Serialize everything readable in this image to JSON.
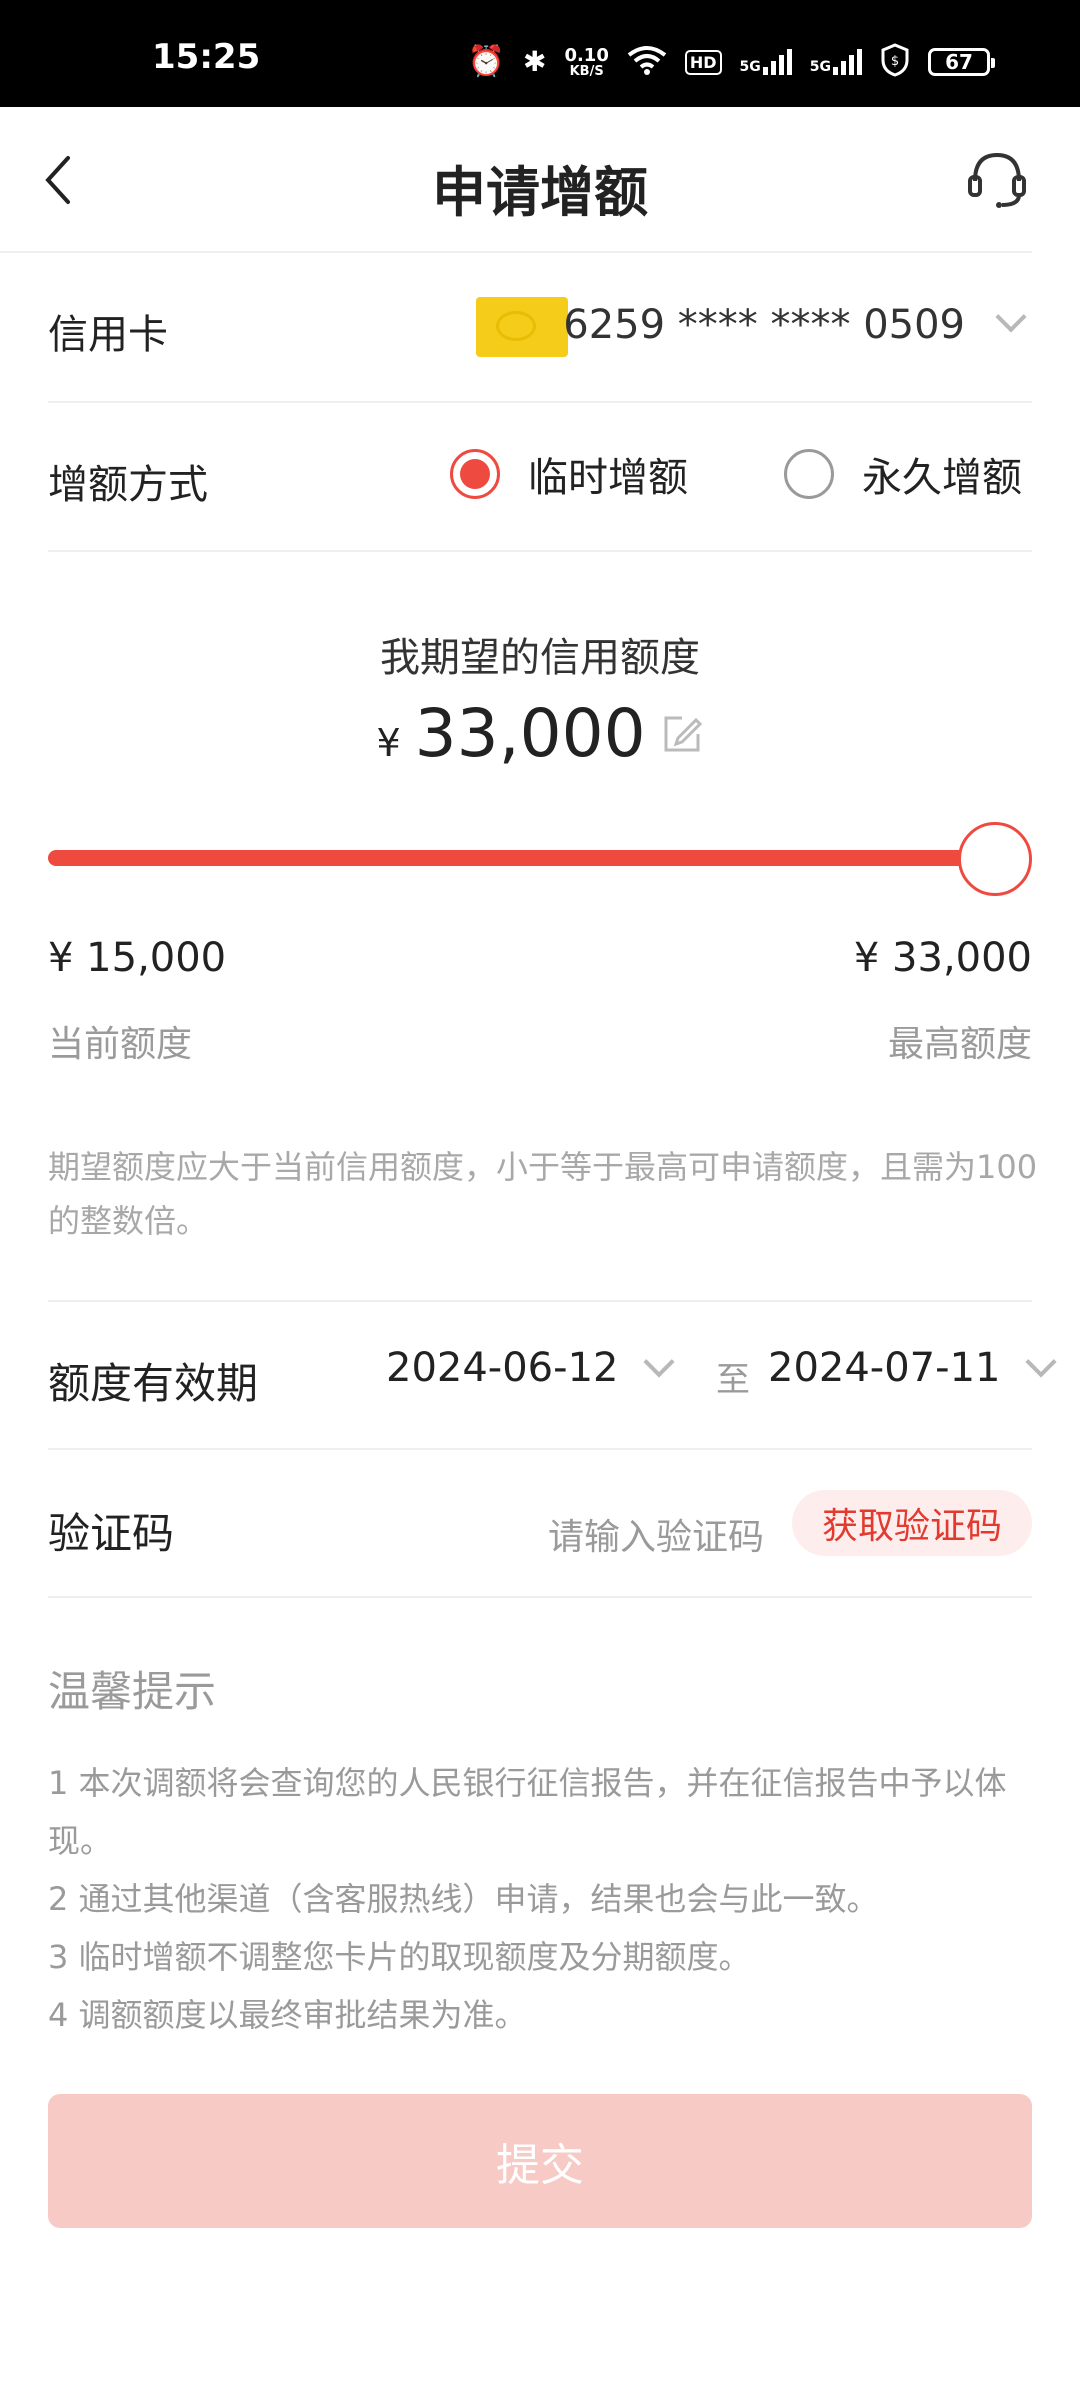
{
  "status_bar": {
    "time": "15:25",
    "net_speed": "0.10",
    "net_unit": "KB/S",
    "hd": "HD",
    "signal_1": "5G",
    "signal_2": "5G",
    "battery": "67"
  },
  "header": {
    "title": "申请增额"
  },
  "card_row": {
    "label": "信用卡",
    "card_number": "6259 **** **** 0509"
  },
  "method_row": {
    "label": "增额方式",
    "options": [
      {
        "label": "临时增额",
        "selected": true
      },
      {
        "label": "永久增额",
        "selected": false
      }
    ]
  },
  "amount": {
    "label": "我期望的信用额度",
    "currency": "¥",
    "value": "33,000"
  },
  "slider": {
    "min_value": "¥ 15,000",
    "max_value": "¥ 33,000",
    "min_label": "当前额度",
    "max_label": "最高额度",
    "fraction": 1.0
  },
  "note": "期望额度应大于当前信用额度，小于等于最高可申请额度，且需为100的整数倍。",
  "validity": {
    "label": "额度有效期",
    "start_date": "2024-06-12",
    "to": "至",
    "end_date": "2024-07-11"
  },
  "verify": {
    "label": "验证码",
    "placeholder": "请输入验证码",
    "button": "获取验证码"
  },
  "tips": {
    "title": "温馨提示",
    "items": [
      "1  本次调额将会查询您的人民银行征信报告，并在征信报告中予以体现。",
      "2  通过其他渠道（含客服热线）申请，结果也会与此一致。",
      "3  临时增额不调整您卡片的取现额度及分期额度。",
      "4  调额额度以最终审批结果为准。"
    ]
  },
  "submit": {
    "label": "提交"
  },
  "colors": {
    "accent": "#ee4a3f",
    "submit_disabled": "#f7cac6",
    "muted_text": "#9a9a9a"
  }
}
